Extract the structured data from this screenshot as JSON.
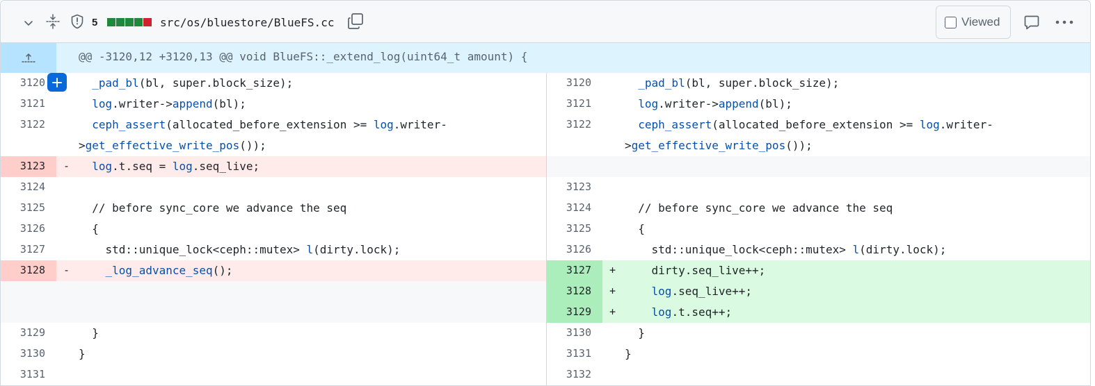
{
  "file": {
    "change_count": "5",
    "diffstat_colors": [
      "#1f883d",
      "#1f883d",
      "#1f883d",
      "#1f883d",
      "#cf222e"
    ],
    "path": "src/os/bluestore/BlueFS.cc",
    "viewed_label": "Viewed",
    "viewed_checked": false,
    "icons": [
      "chevron-down-icon",
      "expand-all-icon",
      "shield-icon",
      "copy-icon",
      "comment-icon",
      "kebab-horizontal-icon"
    ]
  },
  "hunk": {
    "header": "@@ -3120,12 +3120,13 @@ void BlueFS::_extend_log(uint64_t amount) {",
    "expand_icon": "unfold-up-icon"
  },
  "colors": {
    "deletion_bg": "#ffebe9",
    "deletion_num_bg": "#ffcecb",
    "addition_bg": "#dafbe1",
    "addition_num_bg": "#aceebb",
    "hunk_bg": "#ddf4ff",
    "function_name": "#0550ae"
  },
  "left": [
    {
      "num": "3120",
      "marker": "",
      "type": "ctx",
      "code": "  _pad_bl(bl, super.block_size);"
    },
    {
      "num": "3121",
      "marker": "",
      "type": "ctx",
      "code": "  log.writer->append(bl);"
    },
    {
      "num": "3122",
      "marker": "",
      "type": "ctx",
      "code": "  ceph_assert(allocated_before_extension >= log.writer-\n>get_effective_write_pos());"
    },
    {
      "num": "3123",
      "marker": "-",
      "type": "del",
      "code": "  log.t.seq = log.seq_live;"
    },
    {
      "num": "3124",
      "marker": "",
      "type": "ctx",
      "code": ""
    },
    {
      "num": "3125",
      "marker": "",
      "type": "ctx",
      "code": "  // before sync_core we advance the seq"
    },
    {
      "num": "3126",
      "marker": "",
      "type": "ctx",
      "code": "  {"
    },
    {
      "num": "3127",
      "marker": "",
      "type": "ctx",
      "code": "    std::unique_lock<ceph::mutex> l(dirty.lock);"
    },
    {
      "num": "3128",
      "marker": "-",
      "type": "del",
      "code": "    _log_advance_seq();"
    },
    {
      "num": "",
      "marker": "",
      "type": "empty",
      "code": ""
    },
    {
      "num": "",
      "marker": "",
      "type": "empty",
      "code": ""
    },
    {
      "num": "3129",
      "marker": "",
      "type": "ctx",
      "code": "  }"
    },
    {
      "num": "3130",
      "marker": "",
      "type": "ctx",
      "code": "}"
    },
    {
      "num": "3131",
      "marker": "",
      "type": "ctx",
      "code": ""
    }
  ],
  "right": [
    {
      "num": "3120",
      "marker": "",
      "type": "ctx",
      "code": "  _pad_bl(bl, super.block_size);"
    },
    {
      "num": "3121",
      "marker": "",
      "type": "ctx",
      "code": "  log.writer->append(bl);"
    },
    {
      "num": "3122",
      "marker": "",
      "type": "ctx",
      "code": "  ceph_assert(allocated_before_extension >= log.writer-\n>get_effective_write_pos());"
    },
    {
      "num": "",
      "marker": "",
      "type": "empty",
      "code": ""
    },
    {
      "num": "3123",
      "marker": "",
      "type": "ctx",
      "code": ""
    },
    {
      "num": "3124",
      "marker": "",
      "type": "ctx",
      "code": "  // before sync_core we advance the seq"
    },
    {
      "num": "3125",
      "marker": "",
      "type": "ctx",
      "code": "  {"
    },
    {
      "num": "3126",
      "marker": "",
      "type": "ctx",
      "code": "    std::unique_lock<ceph::mutex> l(dirty.lock);"
    },
    {
      "num": "3127",
      "marker": "+",
      "type": "add",
      "code": "    dirty.seq_live++;"
    },
    {
      "num": "3128",
      "marker": "+",
      "type": "add",
      "code": "    log.seq_live++;"
    },
    {
      "num": "3129",
      "marker": "+",
      "type": "add",
      "code": "    log.t.seq++;"
    },
    {
      "num": "3130",
      "marker": "",
      "type": "ctx",
      "code": "  }"
    },
    {
      "num": "3131",
      "marker": "",
      "type": "ctx",
      "code": "}"
    },
    {
      "num": "3132",
      "marker": "",
      "type": "ctx",
      "code": ""
    }
  ]
}
